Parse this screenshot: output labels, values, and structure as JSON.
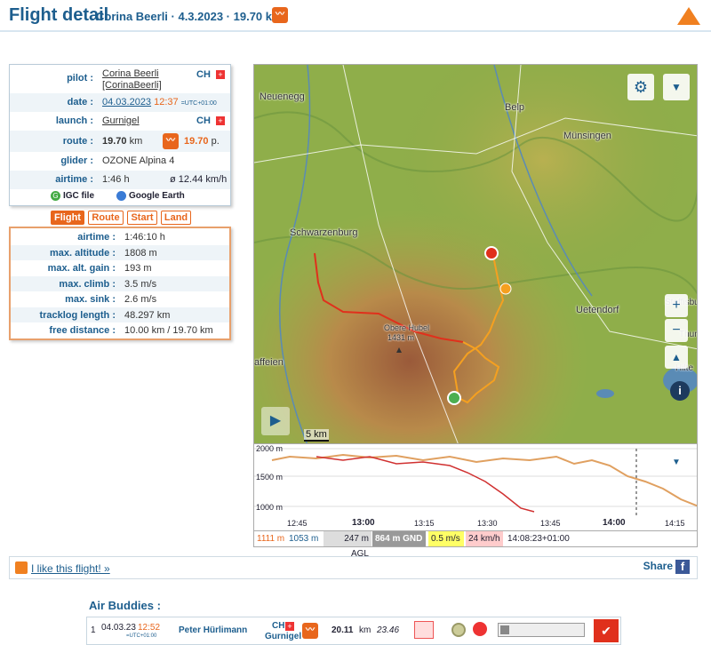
{
  "header": {
    "title": "Flight detail",
    "subtitle": "Corina Beerli · 4.3.2023 · 19.70 km"
  },
  "info": {
    "pilot_label": "pilot :",
    "pilot_name": "Corina Beerli",
    "pilot_user": "[CorinaBeerli]",
    "pilot_cc": "CH",
    "date_label": "date :",
    "date": "04.03.2023",
    "time": "12:37",
    "tz": "=UTC+01:00",
    "launch_label": "launch :",
    "launch": "Gurnigel",
    "launch_cc": "CH",
    "route_label": "route :",
    "route_dist": "19.70",
    "route_unit": "km",
    "route_points": "19.70",
    "route_points_unit": "p.",
    "glider_label": "glider :",
    "glider": "OZONE Alpina 4",
    "airtime_label": "airtime :",
    "airtime": "1:46 h",
    "speed": "ø 12.44 km/h",
    "igc": "IGC file",
    "gearth": "Google Earth"
  },
  "tabs": [
    "Flight",
    "Route",
    "Start",
    "Land"
  ],
  "stats": [
    {
      "label": "airtime :",
      "value": "1:46:10 h"
    },
    {
      "label": "max. altitude :",
      "value": "1808 m"
    },
    {
      "label": "max. alt. gain :",
      "value": "193 m"
    },
    {
      "label": "max. climb :",
      "value": "3.5 m/s"
    },
    {
      "label": "max. sink :",
      "value": "2.6 m/s"
    },
    {
      "label": "tracklog length :",
      "value": "48.297 km"
    },
    {
      "label": "free distance :",
      "value": "10.00 km / 19.70 km"
    }
  ],
  "map": {
    "places": [
      "Neuenegg",
      "Belp",
      "Münsingen",
      "Schwarzenburg",
      "Uetendorf",
      "Obere Hubel",
      "1431 m",
      "affeien",
      "Steffisburg",
      "Thun",
      "Hilte"
    ],
    "scale": "5 km"
  },
  "profile": {
    "y_labels": [
      "2000 m",
      "1500 m",
      "1000 m"
    ],
    "x_labels": [
      "12:45",
      "13:00",
      "13:15",
      "13:30",
      "13:45",
      "14:00",
      "14:15"
    ]
  },
  "status": {
    "alt": "1111 m",
    "gnd": "1053 m",
    "agl": "247 m AGL",
    "gndh": "864 m GND",
    "vario": "0.5 m/s",
    "speed": "24 km/h",
    "time": "14:08:23+01:00"
  },
  "like": {
    "text": "I like this flight! »",
    "share": "Share"
  },
  "buddies": {
    "title": "Air Buddies :",
    "num": "1",
    "date": "04.03.23",
    "time": "12:52",
    "tz": "=UTC+01:00",
    "pilot": "Peter Hürlimann",
    "cc": "CH",
    "launch": "Gurnigel",
    "dist": "20.11",
    "unit": "km",
    "points": "23.46"
  }
}
